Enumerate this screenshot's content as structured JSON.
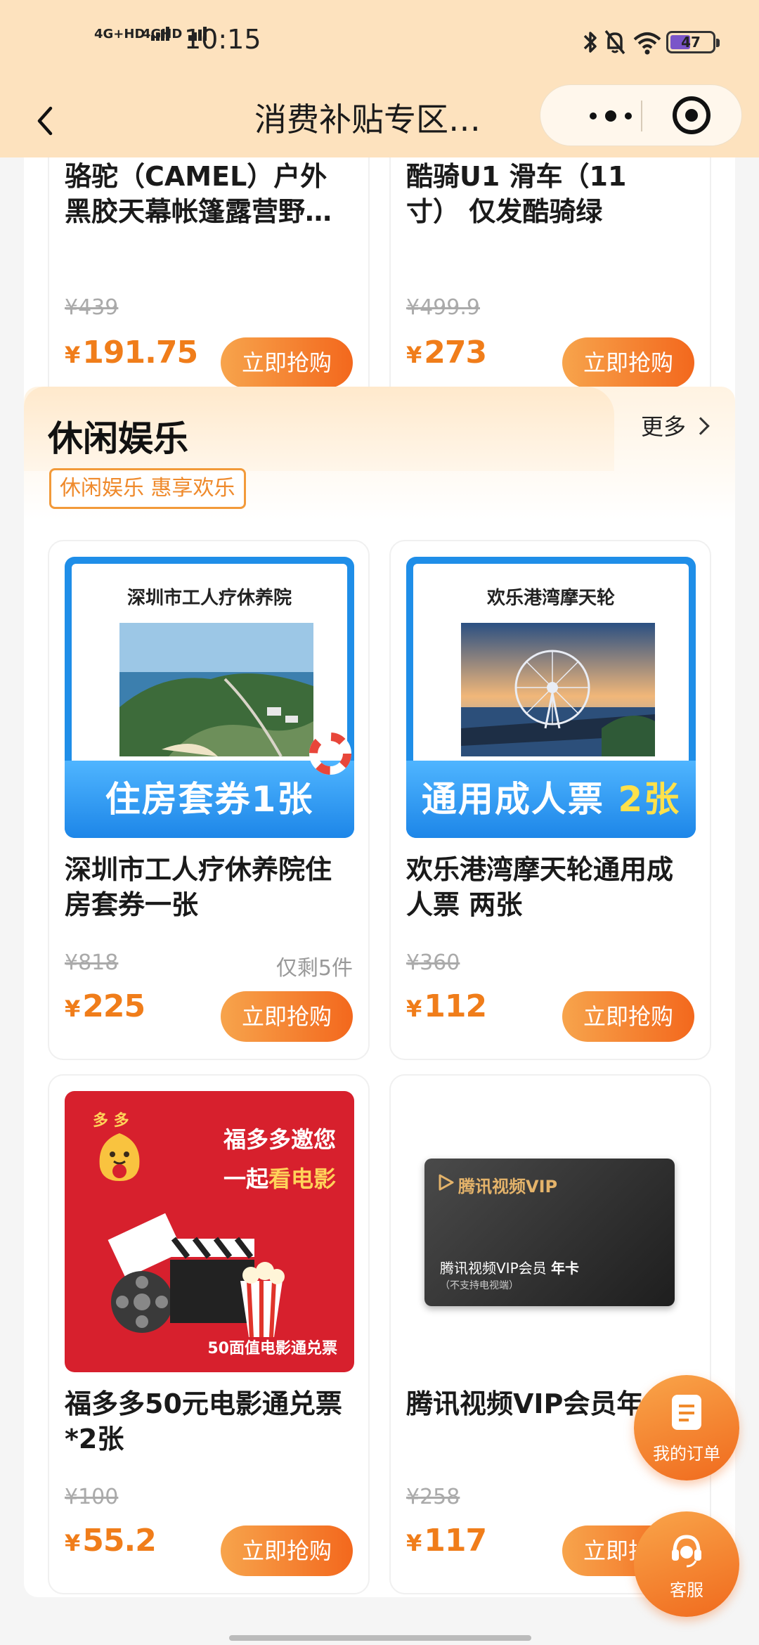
{
  "status": {
    "net1": "4G+HD",
    "net2": "4GHD",
    "time": "10:15",
    "battery": "47"
  },
  "nav": {
    "title": "消费补贴专区…"
  },
  "top_cards": [
    {
      "name": "骆驼（CAMEL）户外\n黑胶天幕帐篷露营野…",
      "orig": "¥439",
      "price": "191.75",
      "buy": "立即抢购"
    },
    {
      "name": "酷骑U1 滑车（11\n寸） 仅发酷骑绿",
      "orig": "¥499.9",
      "price": "273",
      "buy": "立即抢购"
    }
  ],
  "section": {
    "title": "休闲娱乐",
    "more": "更多",
    "tag": "休闲娱乐 惠享欢乐"
  },
  "cards": [
    {
      "img_caption": "深圳市工人疗休养院",
      "img_band_a": "住房套券1张",
      "img_band_b": "",
      "name": "深圳市工人疗休养院住\n房套券一张",
      "orig": "¥818",
      "stock": "仅剩5件",
      "price": "225",
      "buy": "立即抢购"
    },
    {
      "img_caption": "欢乐港湾摩天轮",
      "img_band_a": "通用成人票",
      "img_band_b": "2张",
      "name": "欢乐港湾摩天轮通用成\n人票 两张",
      "orig": "¥360",
      "stock": "",
      "price": "112",
      "buy": "立即抢购"
    },
    {
      "img_brand": "多 多",
      "img_line1": "福多多邀您",
      "img_line2a": "一起",
      "img_line2b": "看电影",
      "img_foot": "50面值电影通兑票",
      "name": "福多多50元电影通兑票\n*2张",
      "orig": "¥100",
      "stock": "",
      "price": "55.2",
      "buy": "立即抢购"
    },
    {
      "img_brand": "腾讯视频VIP",
      "img_line1": "腾讯视频VIP会员",
      "img_line1b": "年卡",
      "img_sub": "（不支持电视端）",
      "name": "腾讯视频VIP会员年卡",
      "orig": "¥258",
      "stock": "",
      "price": "117",
      "buy": "立即抢购"
    }
  ],
  "currency": "¥",
  "float": {
    "orders": "我的订单",
    "service": "客服"
  },
  "colors": {
    "accent": "#f07d1a",
    "nav_bg": "#fde2be"
  }
}
